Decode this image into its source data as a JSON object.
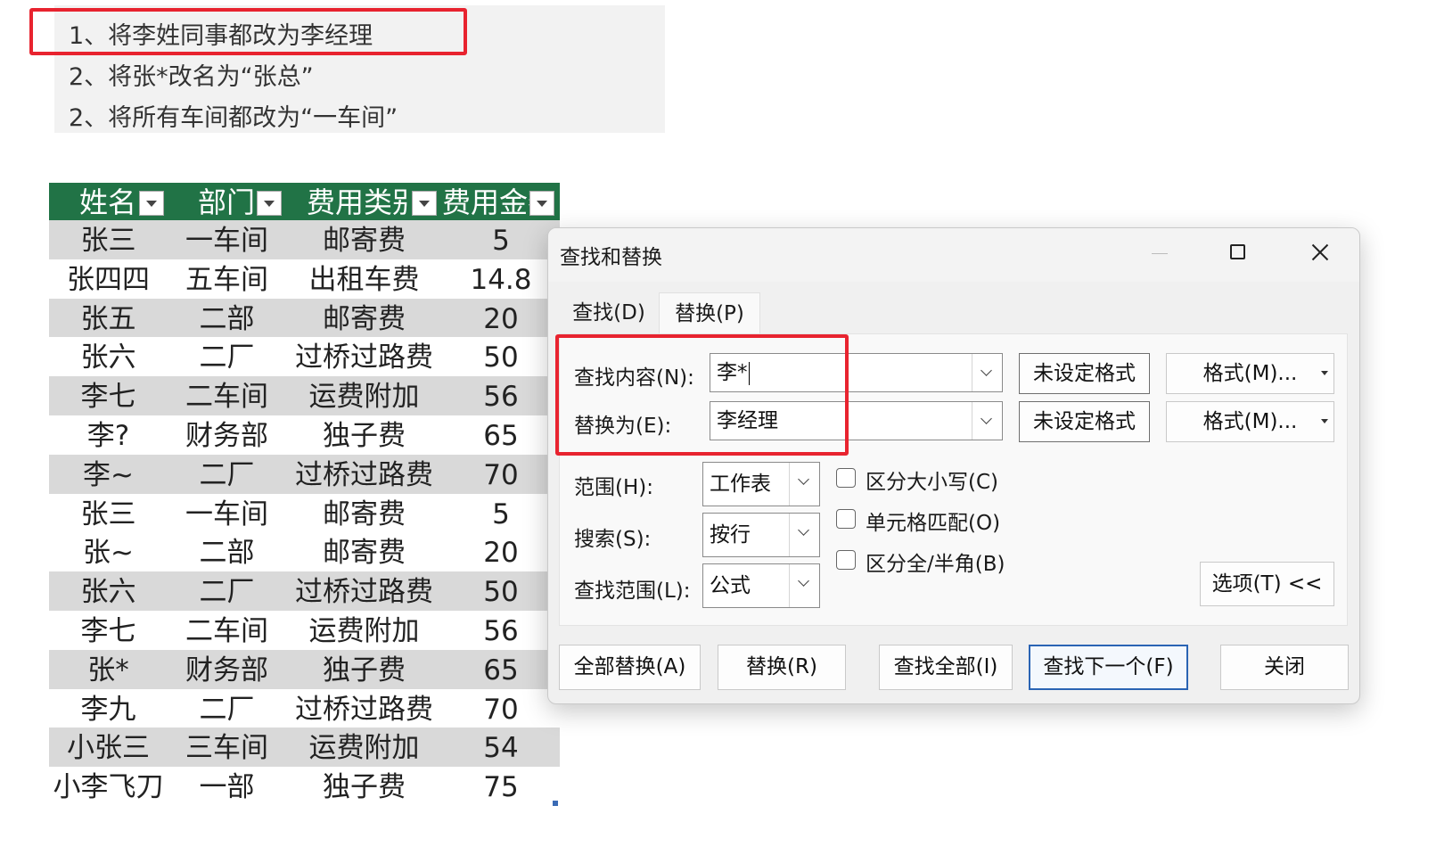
{
  "notes": [
    "1、将李姓同事都改为李经理",
    "2、将张*改名为“张总”",
    "2、将所有车间都改为“一车间”"
  ],
  "sheet": {
    "headers": [
      "姓名",
      "部门",
      "费用类别",
      "费用金额"
    ],
    "rows": [
      [
        "张三",
        "一车间",
        "邮寄费",
        "5"
      ],
      [
        "张四四",
        "五车间",
        "出租车费",
        "14.8"
      ],
      [
        "张五",
        "二部",
        "邮寄费",
        "20"
      ],
      [
        "张六",
        "二厂",
        "过桥过路费",
        "50"
      ],
      [
        "李七",
        "二车间",
        "运费附加",
        "56"
      ],
      [
        "李?",
        "财务部",
        "独子费",
        "65"
      ],
      [
        "李~",
        "二厂",
        "过桥过路费",
        "70"
      ],
      [
        "张三",
        "一车间",
        "邮寄费",
        "5"
      ],
      [
        "张~",
        "二部",
        "邮寄费",
        "20"
      ],
      [
        "张六",
        "二厂",
        "过桥过路费",
        "50"
      ],
      [
        "李七",
        "二车间",
        "运费附加",
        "56"
      ],
      [
        "张*",
        "财务部",
        "独子费",
        "65"
      ],
      [
        "李九",
        "二厂",
        "过桥过路费",
        "70"
      ],
      [
        "小张三",
        "三车间",
        "运费附加",
        "54"
      ],
      [
        "小李飞刀",
        "一部",
        "独子费",
        "75"
      ]
    ],
    "header_color": "#217346",
    "band_color": "#d9d9d9"
  },
  "dialog": {
    "title": "查找和替换",
    "tabs": {
      "find": "查找(D)",
      "replace": "替换(P)"
    },
    "find_label": "查找内容(N):",
    "find_value": "李*",
    "replace_label": "替换为(E):",
    "replace_value": "李经理",
    "no_format": "未设定格式",
    "format_button": "格式(M)...",
    "scope_label": "范围(H):",
    "scope_value": "工作表",
    "search_label": "搜索(S):",
    "search_value": "按行",
    "lookin_label": "查找范围(L):",
    "lookin_value": "公式",
    "options": {
      "match_case": "区分大小写(C)",
      "match_cell": "单元格匹配(O)",
      "match_width": "区分全/半角(B)"
    },
    "options_button": "选项(T) <<",
    "buttons": {
      "replace_all": "全部替换(A)",
      "replace": "替换(R)",
      "find_all": "查找全部(I)",
      "find_next": "查找下一个(F)",
      "close": "关闭"
    }
  },
  "accent_color": "#e8232f"
}
